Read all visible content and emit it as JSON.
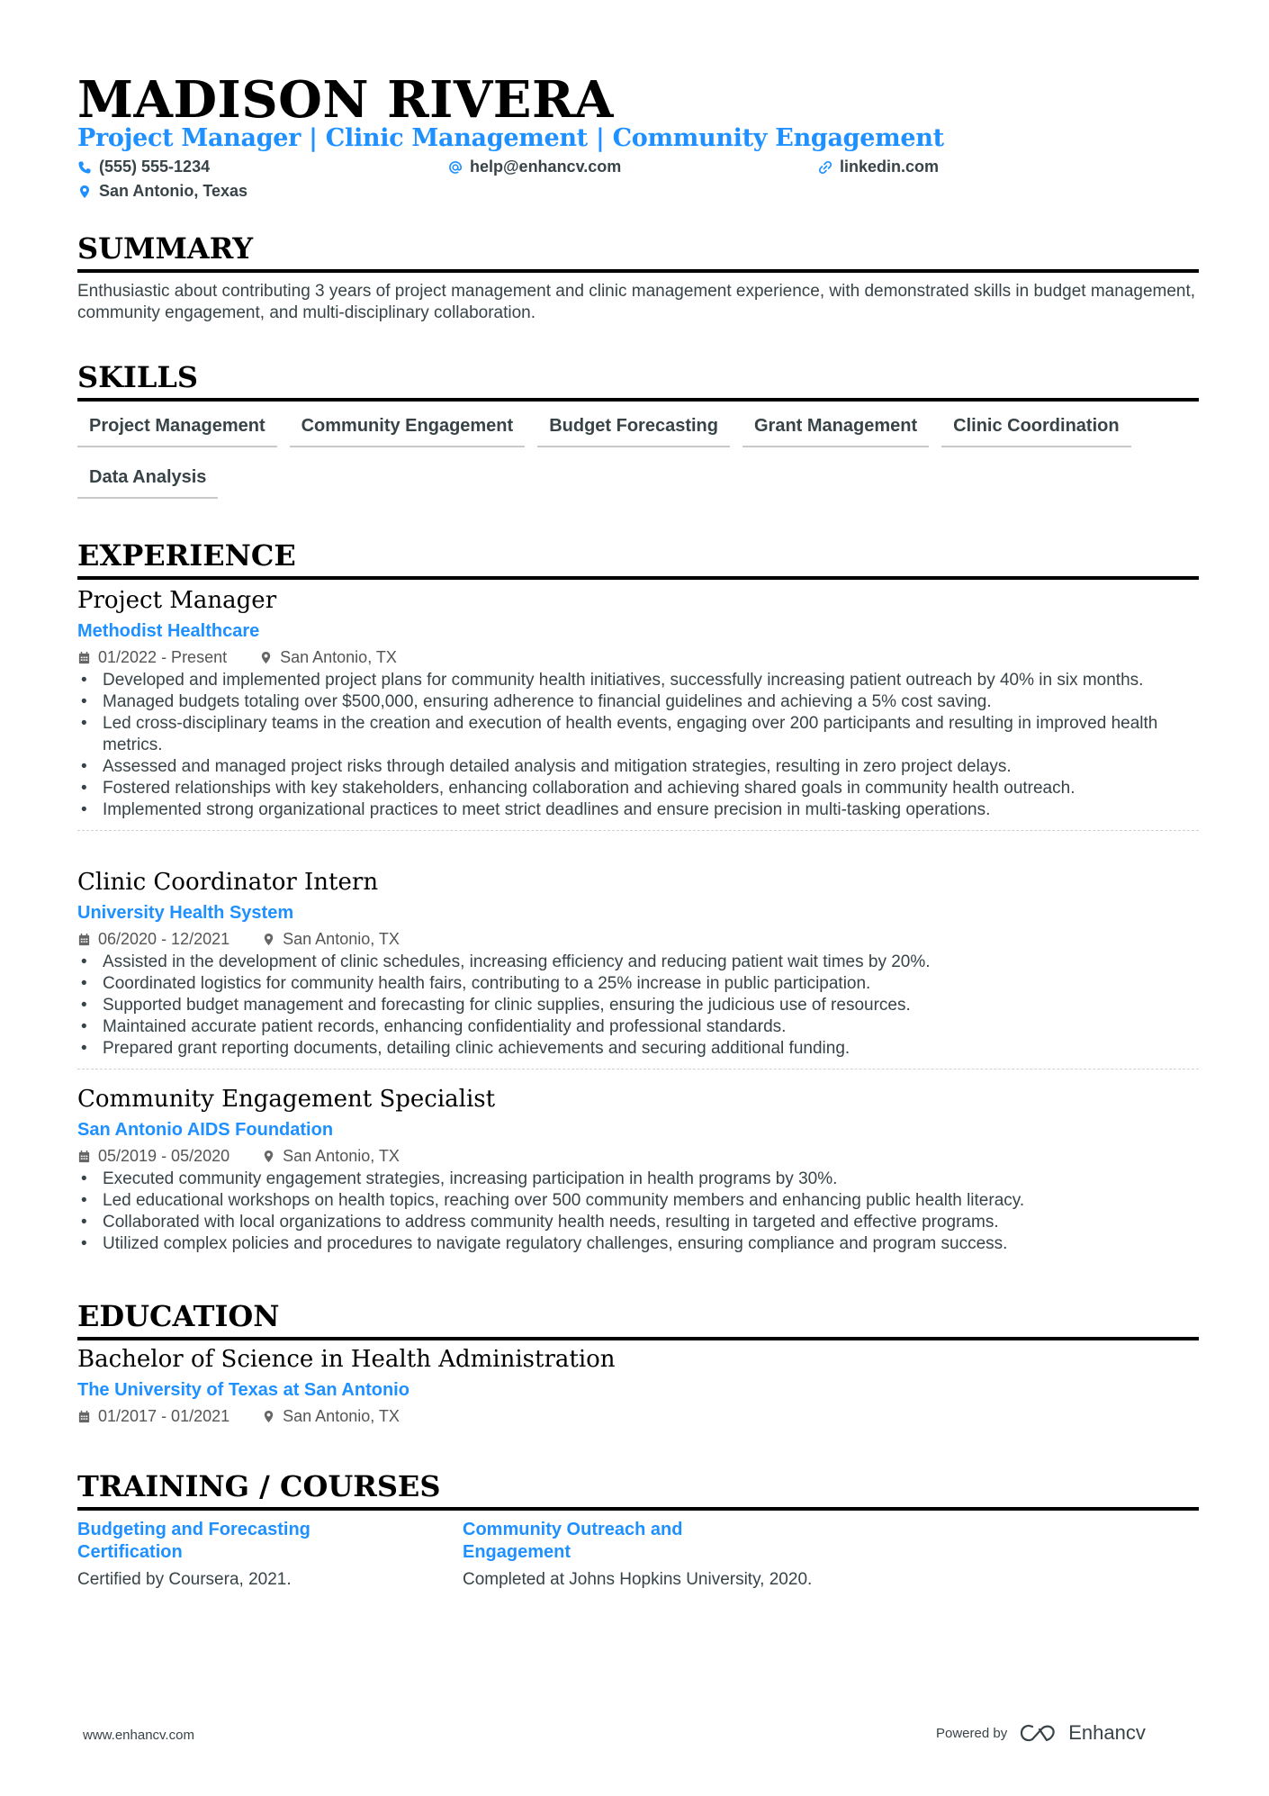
{
  "header": {
    "name": "MADISON RIVERA",
    "headline": "Project Manager | Clinic Management | Community Engagement",
    "phone": "(555) 555-1234",
    "email": "help@enhancv.com",
    "linkedin": "linkedin.com",
    "location": "San Antonio, Texas"
  },
  "colors": {
    "accent": "#1e90ff",
    "text": "#384347",
    "heading": "#000000"
  },
  "summary": {
    "title": "SUMMARY",
    "text": "Enthusiastic about contributing 3 years of project management and clinic management experience, with demonstrated skills in budget management, community engagement, and multi-disciplinary collaboration."
  },
  "skills": {
    "title": "SKILLS",
    "items": [
      "Project Management",
      "Community Engagement",
      "Budget Forecasting",
      "Grant Management",
      "Clinic Coordination",
      "Data Analysis"
    ]
  },
  "experience": {
    "title": "EXPERIENCE",
    "jobs": [
      {
        "title": "Project Manager",
        "company": "Methodist Healthcare",
        "dates": "01/2022 - Present",
        "location": "San Antonio, TX",
        "bullets": [
          "Developed and implemented project plans for community health initiatives, successfully increasing patient outreach by 40% in six months.",
          "Managed budgets totaling over $500,000, ensuring adherence to financial guidelines and achieving a 5% cost saving.",
          "Led cross-disciplinary teams in the creation and execution of health events, engaging over 200 participants and resulting in improved health metrics.",
          "Assessed and managed project risks through detailed analysis and mitigation strategies, resulting in zero project delays.",
          "Fostered relationships with key stakeholders, enhancing collaboration and achieving shared goals in community health outreach.",
          "Implemented strong organizational practices to meet strict deadlines and ensure precision in multi-tasking operations."
        ]
      },
      {
        "title": "Clinic Coordinator Intern",
        "company": "University Health System",
        "dates": "06/2020 - 12/2021",
        "location": "San Antonio, TX",
        "bullets": [
          "Assisted in the development of clinic schedules, increasing efficiency and reducing patient wait times by 20%.",
          "Coordinated logistics for community health fairs, contributing to a 25% increase in public participation.",
          "Supported budget management and forecasting for clinic supplies, ensuring the judicious use of resources.",
          "Maintained accurate patient records, enhancing confidentiality and professional standards.",
          "Prepared grant reporting documents, detailing clinic achievements and securing additional funding."
        ]
      },
      {
        "title": "Community Engagement Specialist",
        "company": "San Antonio AIDS Foundation",
        "dates": "05/2019 - 05/2020",
        "location": "San Antonio, TX",
        "bullets": [
          "Executed community engagement strategies, increasing participation in health programs by 30%.",
          "Led educational workshops on health topics, reaching over 500 community members and enhancing public health literacy.",
          "Collaborated with local organizations to address community health needs, resulting in targeted and effective programs.",
          "Utilized complex policies and procedures to navigate regulatory challenges, ensuring compliance and program success."
        ]
      }
    ]
  },
  "education": {
    "title": "EDUCATION",
    "degree": "Bachelor of Science in Health Administration",
    "school": "The University of Texas at San Antonio",
    "dates": "01/2017 - 01/2021",
    "location": "San Antonio, TX"
  },
  "training": {
    "title": "TRAINING / COURSES",
    "items": [
      {
        "title": "Budgeting and Forecasting Certification",
        "desc": "Certified by Coursera, 2021."
      },
      {
        "title": "Community Outreach and Engagement",
        "desc": "Completed at Johns Hopkins University, 2020."
      }
    ]
  },
  "footer": {
    "website": "www.enhancv.com",
    "powered_by": "Powered by",
    "brand": "Enhancv"
  }
}
